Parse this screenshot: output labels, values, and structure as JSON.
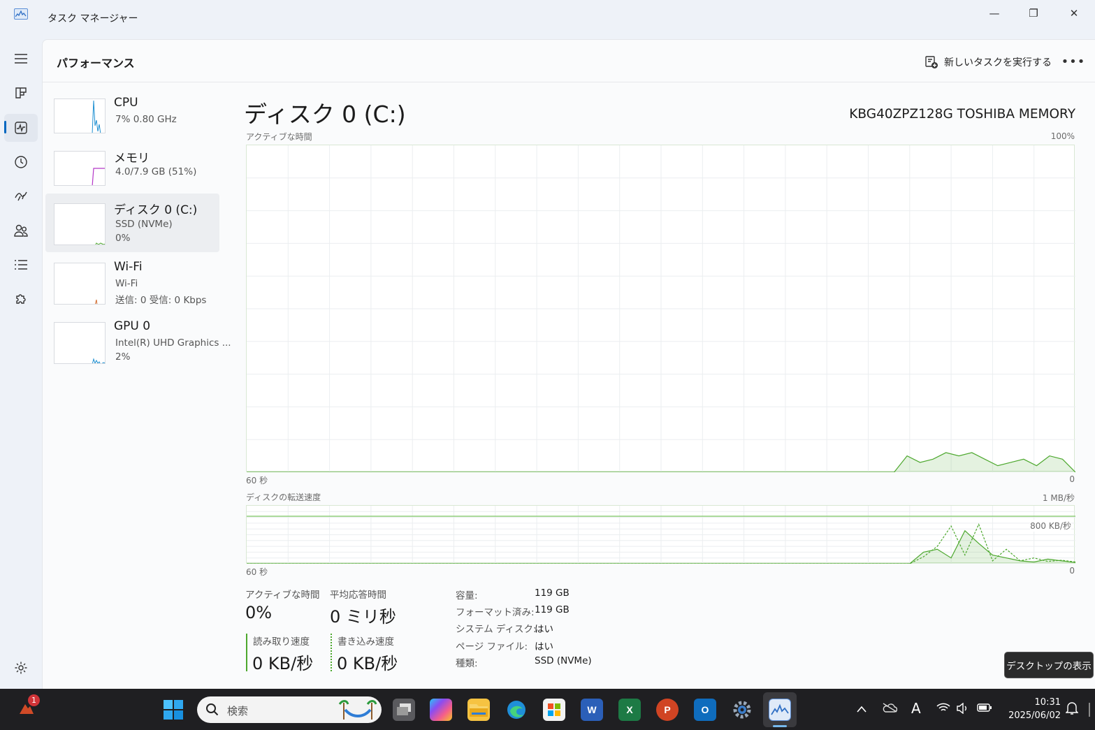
{
  "window": {
    "title": "タスク マネージャー",
    "minimize_glyph": "—",
    "maximize_glyph": "❐",
    "close_glyph": "✕"
  },
  "header": {
    "page_title": "パフォーマンス",
    "run_task_label": "新しいタスクを実行する",
    "more_glyph": "•••"
  },
  "sidebar": {
    "items": [
      {
        "name": "CPU",
        "sub1": "7%  0.80 GHz",
        "sub2": "",
        "color": "#1d8fd1"
      },
      {
        "name": "メモリ",
        "sub1": "4.0/7.9 GB (51%)",
        "sub2": "",
        "color": "#b437c8"
      },
      {
        "name": "ディスク 0 (C:)",
        "sub1": "SSD (NVMe)",
        "sub2": "0%",
        "color": "#4da82e"
      },
      {
        "name": "Wi-Fi",
        "sub1": "Wi-Fi",
        "sub2": "送信: 0  受信: 0 Kbps",
        "color": "#d16c2e"
      },
      {
        "name": "GPU 0",
        "sub1": "Intel(R) UHD Graphics ...",
        "sub2": "2%",
        "color": "#1d8fd1"
      }
    ]
  },
  "detail": {
    "title": "ディスク 0 (C:)",
    "model": "KBG40ZPZ128G TOSHIBA MEMORY",
    "graph1": {
      "label": "アクティブな時間",
      "max_label": "100%",
      "left_label": "60 秒",
      "right_label": "0",
      "values": [
        0,
        0,
        0,
        0,
        0,
        0,
        0,
        0,
        0,
        0,
        0,
        0,
        0,
        0,
        0,
        0,
        0,
        0,
        0,
        0,
        0,
        0,
        0,
        0,
        0,
        0,
        0,
        0,
        0,
        0,
        0,
        0,
        0,
        0,
        0,
        0,
        0,
        0,
        0,
        0,
        0,
        0,
        0,
        0,
        0,
        0,
        0,
        0,
        0,
        0,
        0,
        5,
        3,
        4,
        6,
        5,
        6,
        4,
        2,
        3,
        4,
        2,
        5,
        4,
        0
      ],
      "color": "#4da82e"
    },
    "graph2": {
      "label": "ディスクの転送速度",
      "max_label": "1 MB/秒",
      "ref_label": "800 KB/秒",
      "left_label": "60 秒",
      "right_label": "0",
      "read_values": [
        0,
        0,
        0,
        0,
        0,
        0,
        0,
        0,
        0,
        0,
        0,
        0,
        0,
        0,
        0,
        0,
        0,
        0,
        0,
        0,
        0,
        0,
        0,
        0,
        0,
        0,
        0,
        0,
        0,
        0,
        0,
        0,
        0,
        0,
        0,
        0,
        0,
        0,
        0,
        0,
        0,
        0,
        0,
        0,
        0,
        0,
        0,
        0,
        0,
        20,
        25,
        10,
        57,
        35,
        15,
        10,
        5,
        3,
        8,
        5,
        2
      ],
      "write_values": [
        0,
        0,
        0,
        0,
        0,
        0,
        0,
        0,
        0,
        0,
        0,
        0,
        0,
        0,
        0,
        0,
        0,
        0,
        0,
        0,
        0,
        0,
        0,
        0,
        0,
        0,
        0,
        0,
        0,
        0,
        0,
        0,
        0,
        0,
        0,
        0,
        0,
        0,
        0,
        0,
        0,
        0,
        0,
        0,
        0,
        0,
        0,
        0,
        0,
        12,
        30,
        65,
        15,
        68,
        5,
        25,
        5,
        10,
        4,
        6,
        3
      ],
      "ref_value": 0.82,
      "color": "#4da82e"
    }
  },
  "stats": {
    "active_time_label": "アクティブな時間",
    "active_time_value": "0%",
    "avg_response_label": "平均応答時間",
    "avg_response_value": "0 ミリ秒",
    "read_label": "読み取り速度",
    "read_value": "0 KB/秒",
    "write_label": "書き込み速度",
    "write_value": "0 KB/秒"
  },
  "specs": [
    {
      "key": "容量:",
      "value": "119 GB"
    },
    {
      "key": "フォーマット済み:",
      "value": "119 GB"
    },
    {
      "key": "システム ディスク:",
      "value": "はい"
    },
    {
      "key": "ページ ファイル:",
      "value": "はい"
    },
    {
      "key": "種類:",
      "value": "SSD (NVMe)"
    }
  ],
  "tooltip": "デスクトップの表示",
  "taskbar": {
    "search_placeholder": "検索",
    "notification_badge": "1",
    "time": "10:31",
    "date": "2025/06/02",
    "ime_label": "A"
  }
}
